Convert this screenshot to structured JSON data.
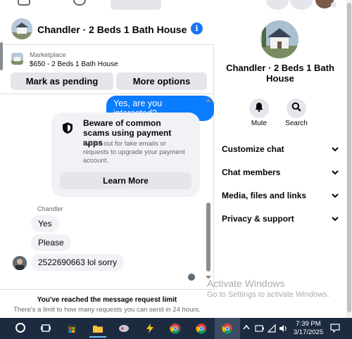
{
  "chat": {
    "header_title": "Chandler · 2 Beds 1 Bath House",
    "marketplace_label": "Marketplace",
    "listing": "$650 - 2 Beds 1 Bath House",
    "mark_pending": "Mark as pending",
    "more_options": "More options",
    "my_message": "Yes, are you interested?",
    "warning_title": "Beware of common scams using payment apps",
    "warning_body": "Watch out for fake emails or requests to upgrade your payment account.",
    "learn_more": "Learn More",
    "sender_name": "Chandler",
    "messages": [
      "Yes",
      "Please",
      "2522690663 lol sorry"
    ],
    "limit_title": "You've reached the message request limit",
    "limit_body": "There's a limit to how many requests you can send in 24 hours."
  },
  "sidebar": {
    "title": "Chandler · 2 Beds 1 Bath House",
    "mute": "Mute",
    "search": "Search",
    "items": [
      "Customize chat",
      "Chat members",
      "Media, files and links",
      "Privacy & support"
    ]
  },
  "watermark": {
    "title": "Activate Windows",
    "subtitle": "Go to Settings to activate Windows."
  },
  "taskbar": {
    "time": "7:39 PM",
    "date": "3/17/2025"
  },
  "colors": {
    "accent": "#0a7cff",
    "info": "#1877f2",
    "taskbar": "#1c2b40"
  }
}
